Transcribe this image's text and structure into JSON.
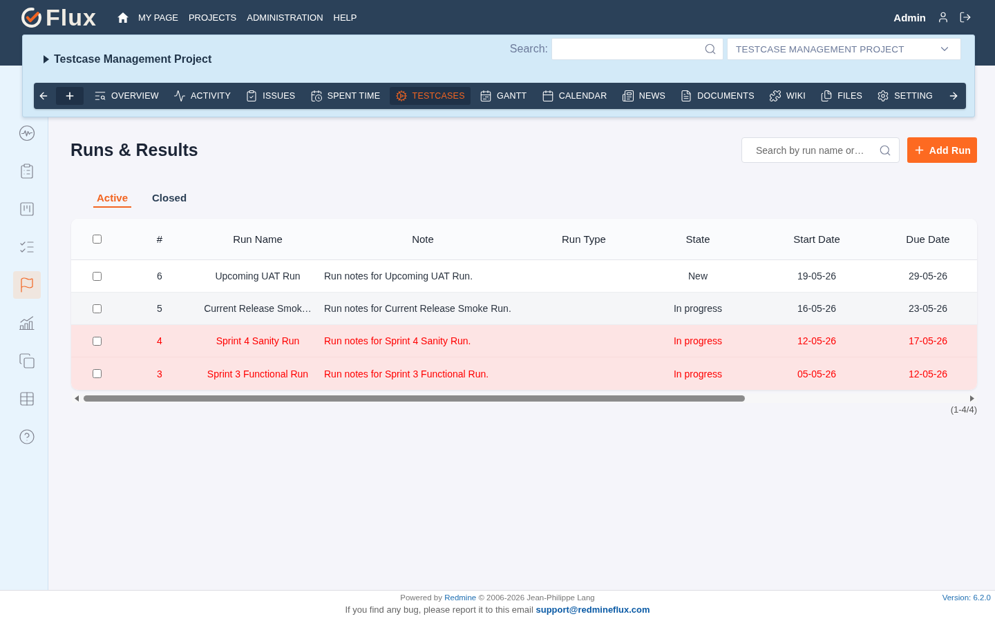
{
  "top_nav": {
    "logo": "Flux",
    "links": [
      "MY PAGE",
      "PROJECTS",
      "ADMINISTRATION",
      "HELP"
    ],
    "user": "Admin"
  },
  "project_panel": {
    "title": "Testcase Management Project",
    "search_label": "Search:",
    "project_select": "TESTCASE MANAGEMENT PROJECT"
  },
  "project_menu": [
    {
      "label": "OVERVIEW",
      "selected": false
    },
    {
      "label": "ACTIVITY",
      "selected": false
    },
    {
      "label": "ISSUES",
      "selected": false
    },
    {
      "label": "SPENT TIME",
      "selected": false
    },
    {
      "label": "TESTCASES",
      "selected": true
    },
    {
      "label": "GANTT",
      "selected": false
    },
    {
      "label": "CALENDAR",
      "selected": false
    },
    {
      "label": "NEWS",
      "selected": false
    },
    {
      "label": "DOCUMENTS",
      "selected": false
    },
    {
      "label": "WIKI",
      "selected": false
    },
    {
      "label": "FILES",
      "selected": false
    },
    {
      "label": "SETTING",
      "selected": false
    }
  ],
  "sidebar": {
    "items": [
      {
        "selected": false
      },
      {
        "selected": false
      },
      {
        "selected": false
      },
      {
        "selected": false
      },
      {
        "selected": true
      },
      {
        "selected": false
      },
      {
        "selected": false
      },
      {
        "selected": false
      },
      {
        "selected": false
      }
    ]
  },
  "page": {
    "title": "Runs & Results",
    "search": {
      "placeholder": "Search by run name or…"
    },
    "add_button": "Add Run"
  },
  "tabs": [
    {
      "label": "Active",
      "selected": true
    },
    {
      "label": "Closed",
      "selected": false
    }
  ],
  "table": {
    "select_all": {
      "checked": false
    },
    "columns": [
      "#",
      "Run Name",
      "Note",
      "Run Type",
      "State",
      "Start Date",
      "Due Date"
    ],
    "rows": [
      {
        "checked": false,
        "overdue": false,
        "id": "6",
        "run_name": "Upcoming UAT Run",
        "note": "Run notes for Upcoming UAT Run.",
        "state": "New",
        "start_date": "19-05-26",
        "due_date": "29-05-26"
      },
      {
        "checked": false,
        "overdue": false,
        "id": "5",
        "run_name": "Current Release Smok…",
        "note": "Run notes for Current Release Smoke Run.",
        "state": "In progress",
        "start_date": "16-05-26",
        "due_date": "23-05-26"
      },
      {
        "checked": false,
        "overdue": true,
        "id": "4",
        "run_name": "Sprint 4 Sanity Run",
        "note": "Run notes for Sprint 4 Sanity Run.",
        "state": "In progress",
        "start_date": "12-05-26",
        "due_date": "17-05-26"
      },
      {
        "checked": false,
        "overdue": true,
        "id": "3",
        "run_name": "Sprint 3 Functional Run",
        "note": "Run notes for Sprint 3 Functional Run.",
        "state": "In progress",
        "start_date": "05-05-26",
        "due_date": "12-05-26"
      }
    ]
  },
  "pagination": "(1-4/4)",
  "footer": {
    "powered_by": {
      "before": "Powered by",
      "link": "Redmine",
      "after": "© 2006-2026 Jean-Philippe Lang"
    },
    "bug_report": {
      "text": "If you find any bug, please report it to this email",
      "email": "support@redmineflux.com"
    },
    "version": "Version: 6.2.0"
  }
}
